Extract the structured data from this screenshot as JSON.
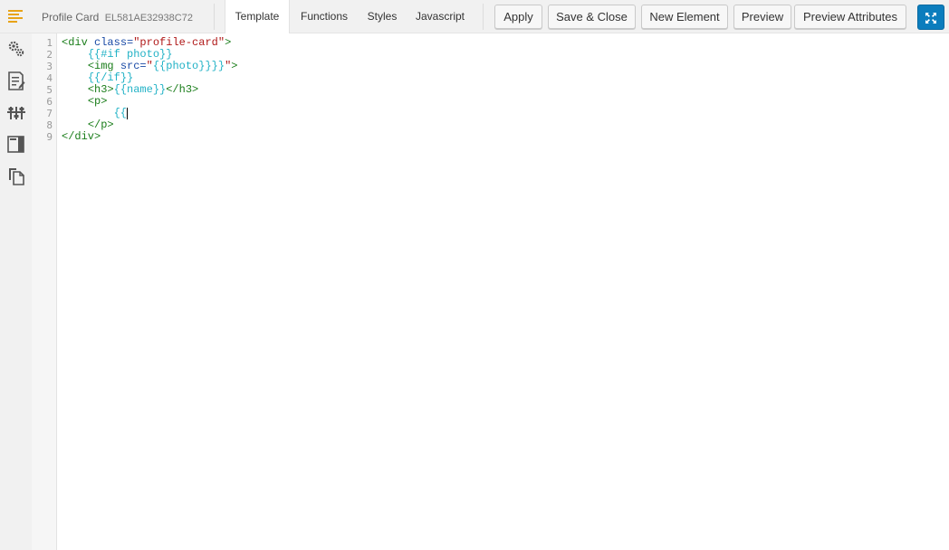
{
  "header": {
    "title": "Profile Card",
    "element_id": "EL581AE32938C72"
  },
  "tabs": [
    {
      "label": "Template",
      "active": true
    },
    {
      "label": "Functions",
      "active": false
    },
    {
      "label": "Styles",
      "active": false
    },
    {
      "label": "Javascript",
      "active": false
    }
  ],
  "toolbar": {
    "apply": "Apply",
    "save_close": "Save & Close",
    "new_element": "New Element",
    "preview": "Preview",
    "preview_attributes": "Preview Attributes"
  },
  "sidebar": {
    "icons": [
      "gears-icon",
      "document-edit-icon",
      "sliders-icon",
      "layout-panel-icon",
      "copy-icon"
    ]
  },
  "colors": {
    "accent": "#0b7dbd",
    "menu_icon": "#e8a317",
    "tag": "#1a7d1a",
    "attr": "#1a4aa6",
    "string": "#b01818",
    "handlebars": "#22b2c6"
  },
  "editor": {
    "line_numbers": [
      "1",
      "2",
      "3",
      "4",
      "5",
      "6",
      "7",
      "8",
      "9"
    ],
    "lines": {
      "l1": {
        "open": "<div",
        "sp": " ",
        "attr": "class=",
        "str": "\"profile-card\"",
        "close": ">"
      },
      "l2": {
        "indent": "    ",
        "hb": "{{#if photo}}"
      },
      "l3": {
        "indent": "    ",
        "open": "<img",
        "sp": " ",
        "attr": "src=",
        "q1": "\"",
        "hb": "{{photo}}}}",
        "q2": "\"",
        "close": ">"
      },
      "l4": {
        "indent": "    ",
        "hb": "{{/if}}"
      },
      "l5": {
        "indent": "    ",
        "open": "<h3>",
        "hb": "{{name}}",
        "close": "</h3>"
      },
      "l6": {
        "indent": "    ",
        "open": "<p>"
      },
      "l7": {
        "indent": "        ",
        "hb": "{{"
      },
      "l8": {
        "indent": "    ",
        "close": "</p>"
      },
      "l9": {
        "close": "</div>"
      }
    }
  }
}
